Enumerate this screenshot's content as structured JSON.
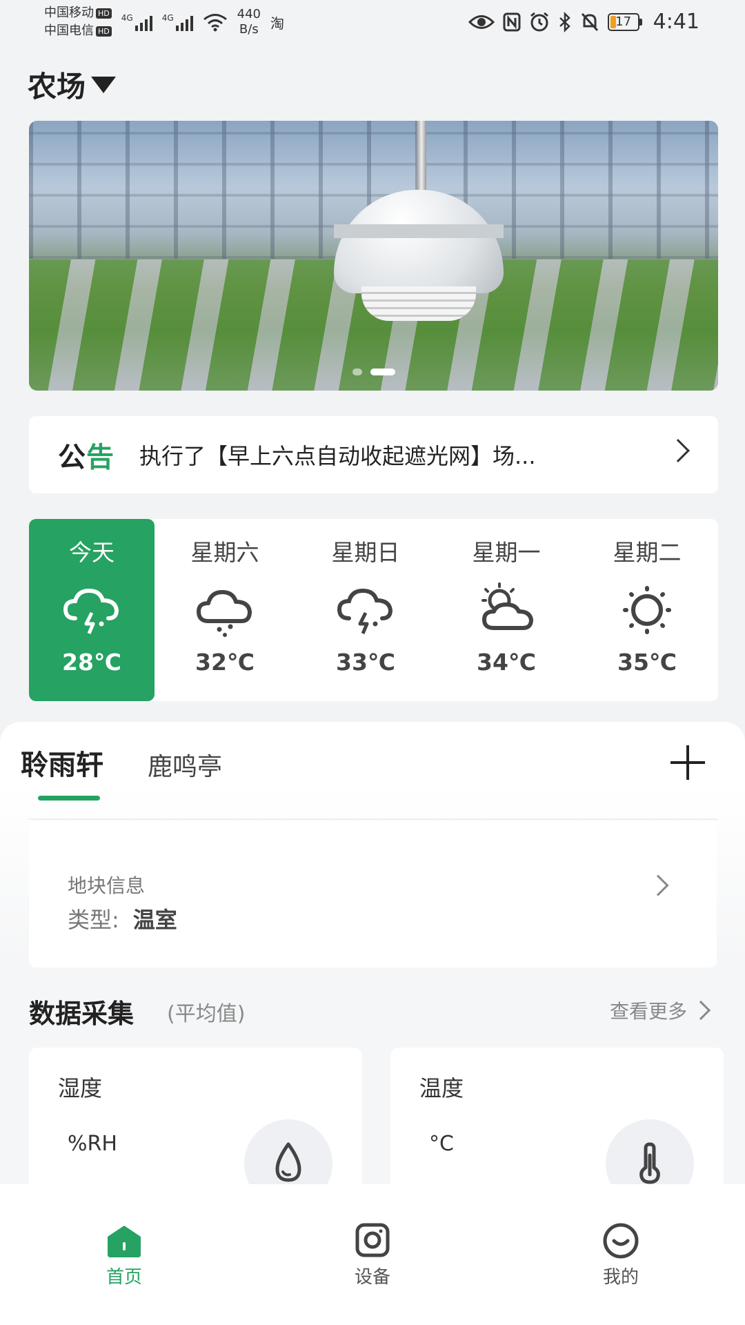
{
  "status_bar": {
    "carrier1": "中国移动",
    "carrier2": "中国电信",
    "hd": "HD",
    "net1": "4G",
    "net2": "4G",
    "speed_value": "440",
    "speed_unit": "B/s",
    "taobao": "淘",
    "battery": "17",
    "time": "4:41"
  },
  "header": {
    "title": "农场"
  },
  "notice": {
    "tag_part1": "公",
    "tag_part2": "告",
    "text": "执行了【早上六点自动收起遮光网】场..."
  },
  "weather": [
    {
      "day": "今天",
      "temp": "28℃",
      "icon": "thunderstorm-icon"
    },
    {
      "day": "星期六",
      "temp": "32℃",
      "icon": "rain-cloud-icon"
    },
    {
      "day": "星期日",
      "temp": "33℃",
      "icon": "thunderstorm-icon"
    },
    {
      "day": "星期一",
      "temp": "34℃",
      "icon": "partly-cloudy-icon"
    },
    {
      "day": "星期二",
      "temp": "35℃",
      "icon": "sun-icon"
    }
  ],
  "tabs": [
    {
      "label": "聆雨轩",
      "active": true
    },
    {
      "label": "鹿鸣亭",
      "active": false
    }
  ],
  "plot": {
    "title": "地块信息",
    "type_label": "类型:",
    "type_value": "温室"
  },
  "data_collection": {
    "title": "数据采集",
    "subtitle": "(平均值)",
    "more": "查看更多",
    "metrics": [
      {
        "name": "湿度",
        "unit": "%RH",
        "icon": "water-drop-icon"
      },
      {
        "name": "温度",
        "unit": "°C",
        "icon": "thermometer-icon"
      }
    ]
  },
  "bottom_nav": [
    {
      "label": "首页",
      "icon": "home-icon",
      "active": true
    },
    {
      "label": "设备",
      "icon": "device-icon",
      "active": false
    },
    {
      "label": "我的",
      "icon": "profile-icon",
      "active": false
    }
  ],
  "colors": {
    "accent": "#26a262",
    "background": "#f2f3f4",
    "card": "#ffffff"
  }
}
